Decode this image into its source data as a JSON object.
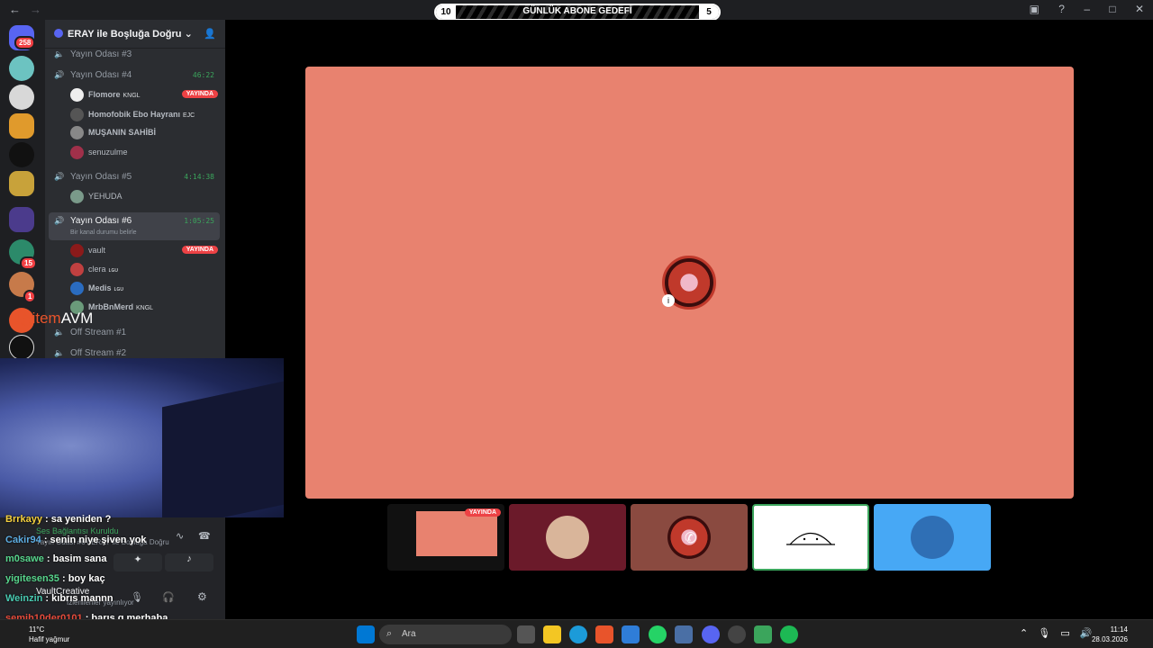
{
  "titlebar": {
    "goal": {
      "left": "10",
      "title": "GÜNLÜK ABONE GEDEFİ",
      "right": "5"
    }
  },
  "rail": {
    "badges": [
      "258",
      "15",
      "1"
    ]
  },
  "brand": {
    "prefix": "item",
    "suffix": "AVM"
  },
  "server": {
    "name": "ERAY ile Boşluğa Doğru"
  },
  "channels": [
    {
      "name": "Yayın Odası #3",
      "time": ""
    },
    {
      "name": "Yayın Odası #4",
      "time": "46:22"
    },
    {
      "name": "Yayın Odası #5",
      "time": "4:14:38"
    },
    {
      "name": "Yayın Odası #6",
      "time": "1:05:25",
      "status": "Bir kanal durumu belirle"
    },
    {
      "name": "Off Stream #1",
      "time": ""
    },
    {
      "name": "Off Stream #2",
      "time": ""
    }
  ],
  "users": {
    "room4": [
      {
        "name": "Flomore",
        "tag": "KNGL",
        "live": "YAYINDA"
      },
      {
        "name": "Homofobik Ebo Hayranı",
        "tag": "EJC"
      },
      {
        "name": "MUŞANIN SAHİBİ"
      },
      {
        "name": "senuzulme"
      }
    ],
    "room5": [
      {
        "name": "YEHUDA"
      }
    ],
    "room6": [
      {
        "name": "vault",
        "live": "YAYINDA"
      },
      {
        "name": "clera",
        "tag": "ʟɢᴜ"
      },
      {
        "name": "Medis",
        "tag": "ʟɢᴜ"
      },
      {
        "name": "MrbBnMerd",
        "tag": "KNGL"
      }
    ]
  },
  "voice": {
    "connection": "Ses Bağlantısı Kuruldu",
    "channel": "Yayın Odası #6 / ERAY ile Boşluğa Doğru",
    "username": "VaultCreative",
    "user_status": "İzlenilenler yayınlıyor"
  },
  "chat": [
    {
      "user": "Brrkayy",
      "message": ": sa yeniden ?",
      "color": "#f4d03f"
    },
    {
      "user": "Cakir94",
      "message": ": senin niye şiven yok",
      "color": "#5dade2"
    },
    {
      "user": "m0sawe",
      "message": ": basim sana",
      "color": "#58d68d"
    },
    {
      "user": "yigitesen35",
      "message": ": boy kaç",
      "color": "#58d68d"
    },
    {
      "user": "Weinzin",
      "message": ": kıbrıs mannn",
      "color": "#48c9b0"
    },
    {
      "user": "semih10der0101",
      "message": ": barış g merhaba",
      "color": "#e74c3c"
    }
  ],
  "stage": {
    "live_label": "YAYINDA"
  },
  "taskbar": {
    "weather_temp": "11°C",
    "weather_desc": "Hafif yağmur",
    "search_placeholder": "Ara",
    "time": "11:14",
    "date": "28.03.2026"
  },
  "colors": {
    "accent": "#5865f2",
    "live": "#ed4245",
    "voice_green": "#3ba55c",
    "stage_bg": "#e8826f"
  }
}
